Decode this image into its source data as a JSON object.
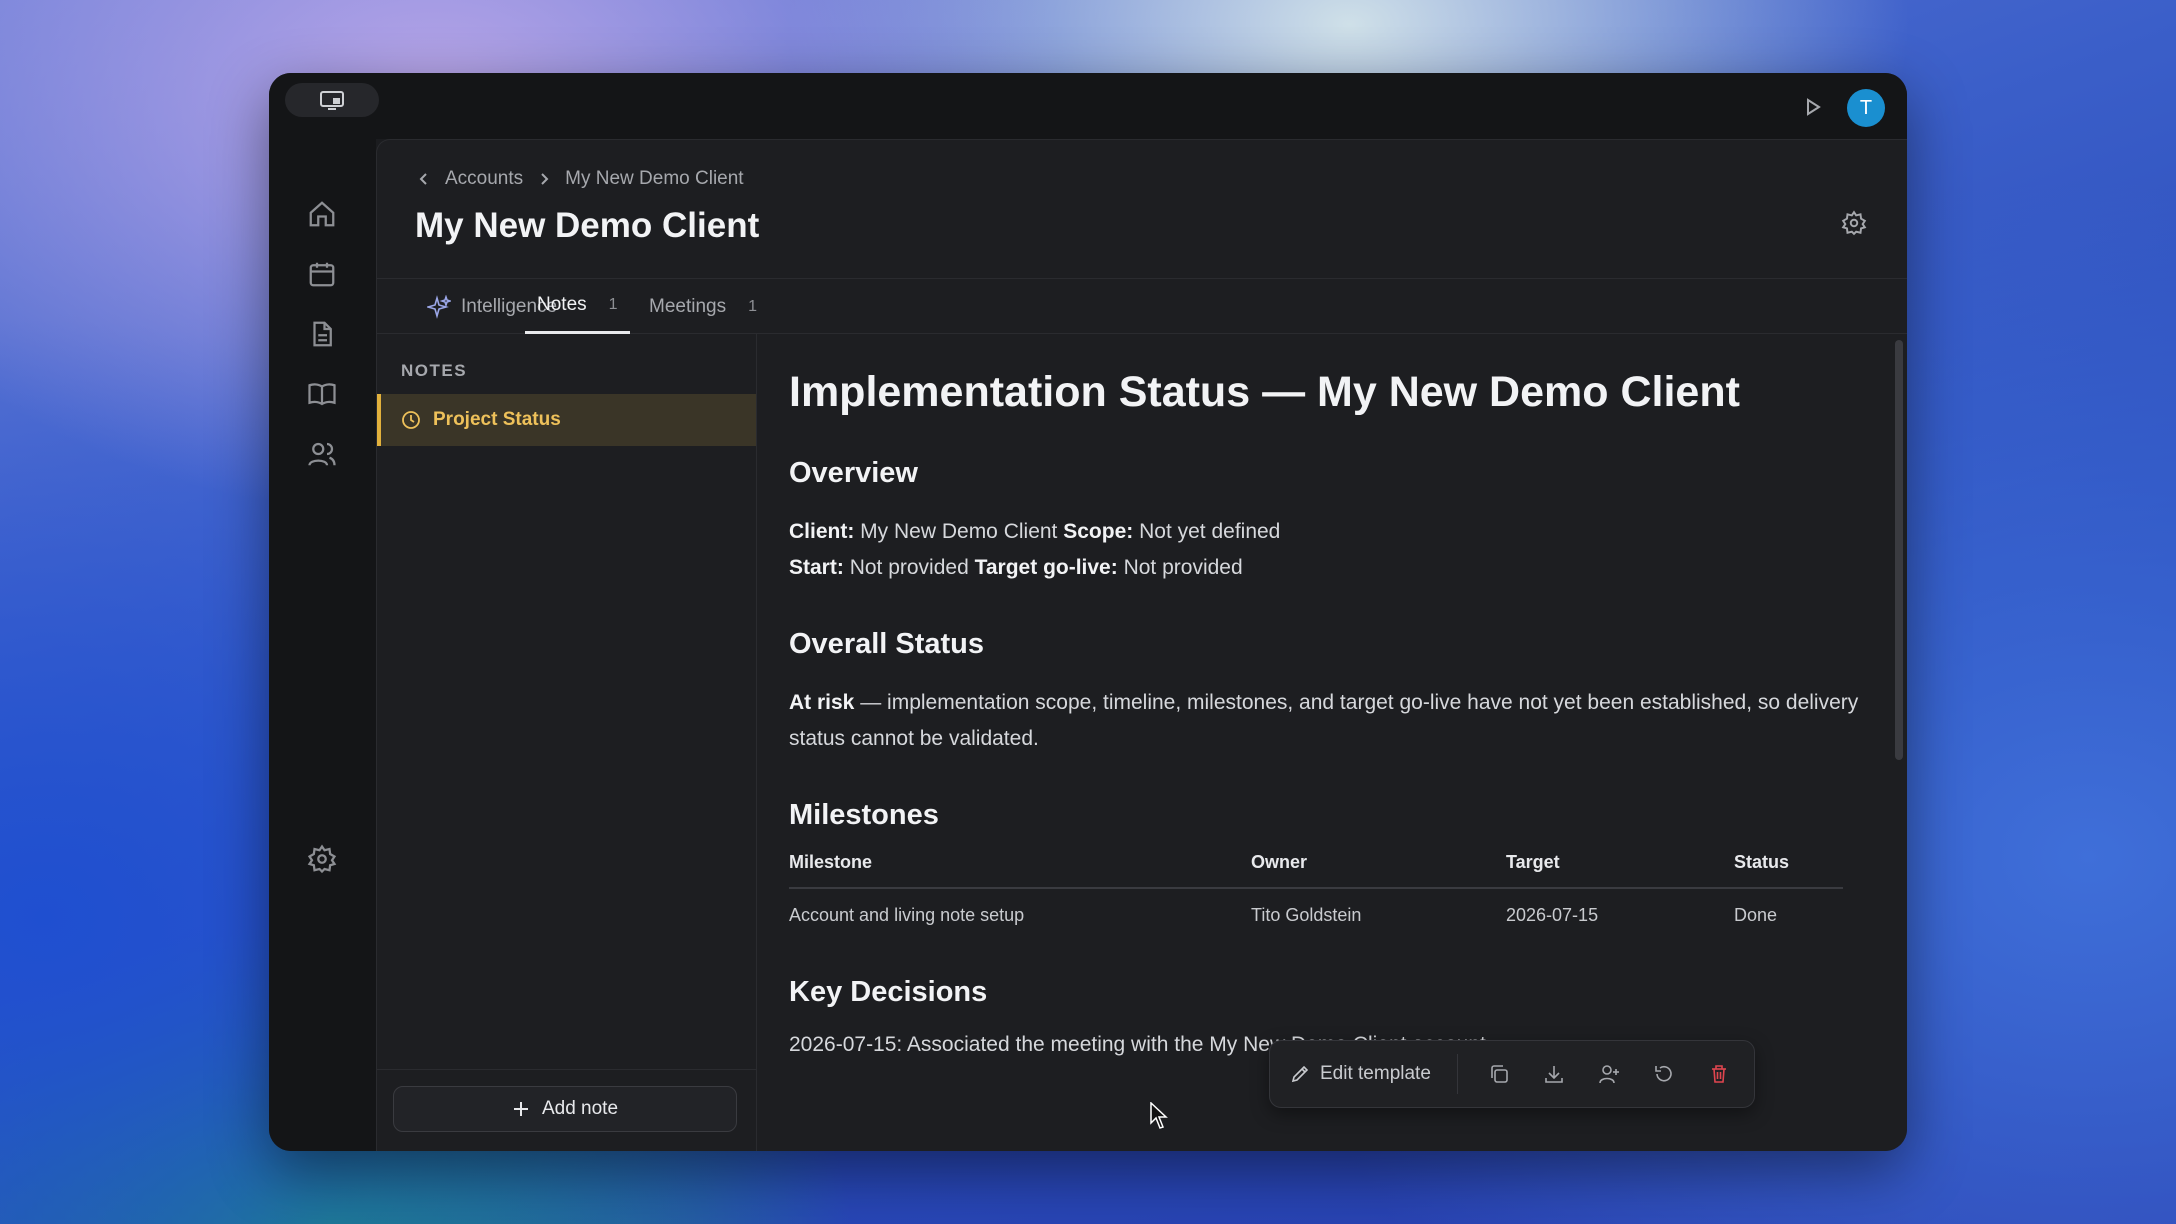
{
  "app": {
    "user_initial": "T"
  },
  "breadcrumb": {
    "parent": "Accounts",
    "current": "My New Demo Client"
  },
  "page_title": "My New Demo Client",
  "tabs": [
    {
      "label": "Intelligence",
      "count": ""
    },
    {
      "label": "Notes",
      "count": "1"
    },
    {
      "label": "Meetings",
      "count": "1"
    }
  ],
  "notes_panel": {
    "heading": "NOTES",
    "items": [
      {
        "label": "Project Status"
      }
    ],
    "add_label": "Add note"
  },
  "document": {
    "title": "Implementation Status — My New Demo Client",
    "overview": {
      "heading": "Overview",
      "client_label": "Client:",
      "client_value": "My New Demo Client",
      "scope_label": "Scope:",
      "scope_value": "Not yet defined",
      "start_label": "Start:",
      "start_value": "Not provided",
      "golive_label": "Target go-live:",
      "golive_value": "Not provided"
    },
    "overall_status": {
      "heading": "Overall Status",
      "status_label": "At risk",
      "status_text": "— implementation scope, timeline, milestones, and target go-live have not yet been established, so delivery status cannot be validated."
    },
    "milestones": {
      "heading": "Milestones",
      "columns": [
        "Milestone",
        "Owner",
        "Target",
        "Status"
      ],
      "rows": [
        [
          "Account and living note setup",
          "Tito Goldstein",
          "2026-07-15",
          "Done"
        ]
      ]
    },
    "key_decisions": {
      "heading": "Key Decisions",
      "items": [
        "2026-07-15: Associated the meeting with the My New Demo Client account."
      ]
    }
  },
  "toolbar": {
    "edit_label": "Edit template",
    "icons": [
      "copy-icon",
      "download-icon",
      "share-user-icon",
      "restore-icon",
      "trash-icon"
    ]
  },
  "colors": {
    "accent_gold": "#e2b13c",
    "avatar_blue": "#1a8fd0",
    "danger_red": "#e0454f"
  }
}
